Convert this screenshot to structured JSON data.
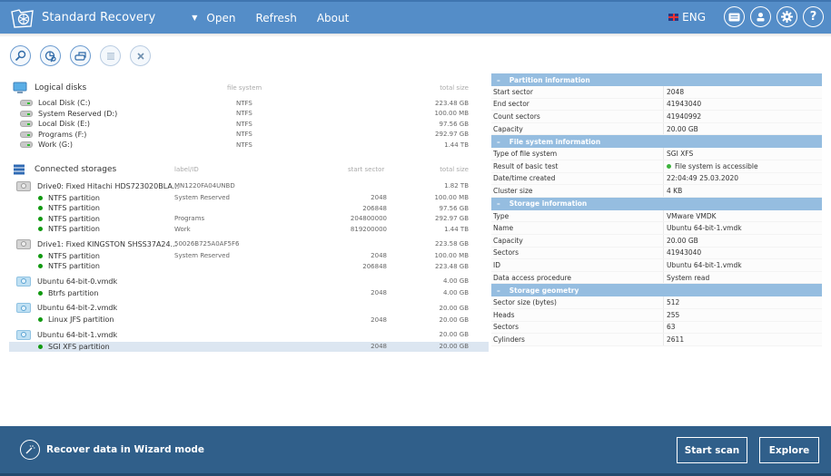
{
  "header": {
    "app_title": "Standard Recovery",
    "menu": {
      "open": "Open",
      "refresh": "Refresh",
      "about": "About"
    },
    "language": "ENG",
    "icons": [
      "license-icon",
      "account-icon",
      "settings-icon",
      "help-icon"
    ],
    "help_glyph": "?",
    "accent_color": "#548dc8"
  },
  "toolbar": {
    "buttons": [
      "search-icon",
      "partition-scan-icon",
      "storage-icon",
      "list-icon",
      "close-icon"
    ]
  },
  "logical_disks": {
    "title": "Logical disks",
    "col_fs": "file system",
    "col_size": "total size",
    "items": [
      {
        "name": "Local Disk (C:)",
        "fs": "NTFS",
        "size": "223.48 GB"
      },
      {
        "name": "System Reserved (D:)",
        "fs": "NTFS",
        "size": "100.00 MB"
      },
      {
        "name": "Local Disk (E:)",
        "fs": "NTFS",
        "size": "97.56 GB"
      },
      {
        "name": "Programs (F:)",
        "fs": "NTFS",
        "size": "292.97 GB"
      },
      {
        "name": "Work (G:)",
        "fs": "NTFS",
        "size": "1.44 TB"
      }
    ]
  },
  "storages": {
    "title": "Connected storages",
    "col_label": "label/ID",
    "col_start": "start sector",
    "col_size": "total size",
    "drives": [
      {
        "name": "Drive0: Fixed Hitachi HDS723020BLA...",
        "id": "MN1220FA04UNBD",
        "size": "1.82 TB",
        "virtual": false,
        "partitions": [
          {
            "name": "NTFS partition",
            "label": "System Reserved",
            "start": "2048",
            "size": "100.00 MB"
          },
          {
            "name": "NTFS partition",
            "label": "",
            "start": "206848",
            "size": "97.56 GB"
          },
          {
            "name": "NTFS partition",
            "label": "Programs",
            "start": "204800000",
            "size": "292.97 GB"
          },
          {
            "name": "NTFS partition",
            "label": "Work",
            "start": "819200000",
            "size": "1.44 TB"
          }
        ]
      },
      {
        "name": "Drive1: Fixed KINGSTON SHSS37A24...",
        "id": "50026B725A0AF5F6",
        "size": "223.58 GB",
        "virtual": false,
        "partitions": [
          {
            "name": "NTFS partition",
            "label": "System Reserved",
            "start": "2048",
            "size": "100.00 MB"
          },
          {
            "name": "NTFS partition",
            "label": "",
            "start": "206848",
            "size": "223.48 GB"
          }
        ]
      },
      {
        "name": "Ubuntu 64-bit-0.vmdk",
        "id": "",
        "size": "4.00 GB",
        "virtual": true,
        "partitions": [
          {
            "name": "Btrfs partition",
            "label": "",
            "start": "2048",
            "size": "4.00 GB"
          }
        ]
      },
      {
        "name": "Ubuntu 64-bit-2.vmdk",
        "id": "",
        "size": "20.00 GB",
        "virtual": true,
        "partitions": [
          {
            "name": "Linux JFS partition",
            "label": "",
            "start": "2048",
            "size": "20.00 GB"
          }
        ]
      },
      {
        "name": "Ubuntu 64-bit-1.vmdk",
        "id": "",
        "size": "20.00 GB",
        "virtual": true,
        "partitions": [
          {
            "name": "SGI XFS partition",
            "label": "",
            "start": "2048",
            "size": "20.00 GB",
            "selected": true
          }
        ]
      }
    ]
  },
  "info": {
    "sections": [
      {
        "title": "Partition information",
        "rows": [
          {
            "k": "Start sector",
            "v": "2048"
          },
          {
            "k": "End sector",
            "v": "41943040"
          },
          {
            "k": "Count sectors",
            "v": "41940992"
          },
          {
            "k": "Capacity",
            "v": "20.00 GB"
          }
        ]
      },
      {
        "title": "File system information",
        "rows": [
          {
            "k": "Type of file system",
            "v": "SGI XFS"
          },
          {
            "k": "Result of basic test",
            "v": "File system is accessible",
            "status": "ok"
          },
          {
            "k": "Date/time created",
            "v": "22:04:49 25.03.2020"
          },
          {
            "k": "Cluster size",
            "v": "4 KB"
          }
        ]
      },
      {
        "title": "Storage information",
        "rows": [
          {
            "k": "Type",
            "v": "VMware VMDK"
          },
          {
            "k": "Name",
            "v": "Ubuntu 64-bit-1.vmdk"
          },
          {
            "k": "Capacity",
            "v": "20.00 GB"
          },
          {
            "k": "Sectors",
            "v": "41943040"
          },
          {
            "k": "ID",
            "v": "Ubuntu 64-bit-1.vmdk"
          },
          {
            "k": "Data access procedure",
            "v": "System read"
          }
        ]
      },
      {
        "title": "Storage geometry",
        "rows": [
          {
            "k": "Sector size (bytes)",
            "v": "512"
          },
          {
            "k": "Heads",
            "v": "255"
          },
          {
            "k": "Sectors",
            "v": "63"
          },
          {
            "k": "Cylinders",
            "v": "2611"
          }
        ]
      }
    ],
    "collapse_glyph": "–"
  },
  "footer": {
    "wizard_label": "Recover data in Wizard mode",
    "start_scan": "Start scan",
    "explore": "Explore"
  }
}
